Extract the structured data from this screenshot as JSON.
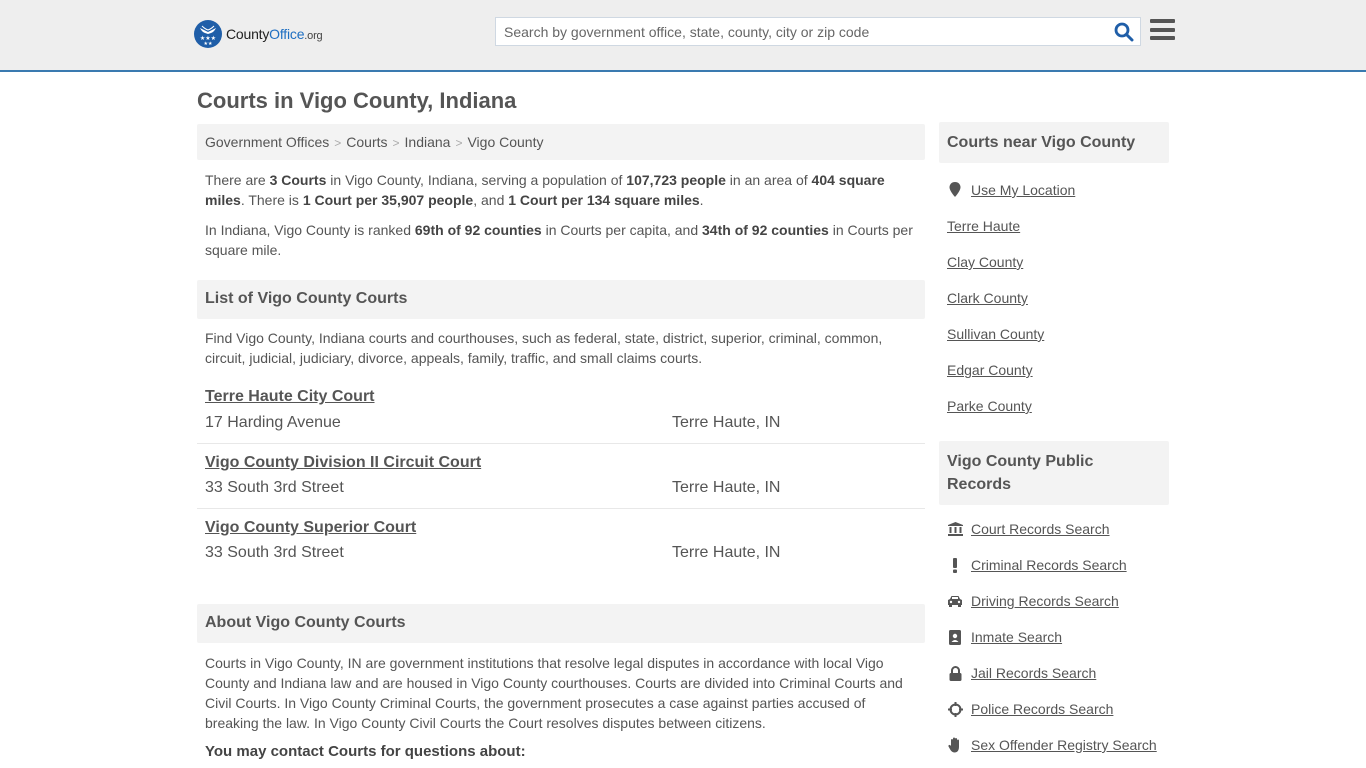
{
  "header": {
    "logo": {
      "county": "County",
      "office": "Office",
      "org": ".org"
    },
    "search_placeholder": "Search by government office, state, county, city or zip code",
    "colors": {
      "accent": "#3a7ab0",
      "brand": "#1f5ea8",
      "search_icon": "#1f5ea8"
    }
  },
  "page": {
    "title": "Courts in Vigo County, Indiana",
    "breadcrumb": [
      "Government Offices",
      "Courts",
      "Indiana",
      "Vigo County"
    ],
    "summary": {
      "t1": "There are ",
      "b1": "3 Courts",
      "t2": " in Vigo County, Indiana, serving a population of ",
      "b2": "107,723 people",
      "t3": " in an area of ",
      "b3": "404 square miles",
      "t4": ". There is ",
      "b4": "1 Court per 35,907 people",
      "t5": ", and ",
      "b5": "1 Court per 134 square miles",
      "t6": "."
    },
    "ranking": {
      "t1": "In Indiana, Vigo County is ranked ",
      "b1": "69th of 92 counties",
      "t2": " in Courts per capita, and ",
      "b2": "34th of 92 counties",
      "t3": " in Courts per square mile."
    },
    "list_heading": "List of Vigo County Courts",
    "list_intro": "Find Vigo County, Indiana courts and courthouses, such as federal, state, district, superior, criminal, common, circuit, judicial, judiciary, divorce, appeals, family, traffic, and small claims courts.",
    "courts": [
      {
        "name": "Terre Haute City Court",
        "address": "17 Harding Avenue",
        "city": "Terre Haute, IN"
      },
      {
        "name": "Vigo County Division II Circuit Court",
        "address": "33 South 3rd Street",
        "city": "Terre Haute, IN"
      },
      {
        "name": "Vigo County Superior Court",
        "address": "33 South 3rd Street",
        "city": "Terre Haute, IN"
      }
    ],
    "about_heading": "About Vigo County Courts",
    "about_text": "Courts in Vigo County, IN are government institutions that resolve legal disputes in accordance with local Vigo County and Indiana law and are housed in Vigo County courthouses. Courts are divided into Criminal Courts and Civil Courts. In Vigo County Criminal Courts, the government prosecutes a case against parties accused of breaking the law. In Vigo County Civil Courts the Court resolves disputes between citizens.",
    "contact_heading": "You may contact Courts for questions about:"
  },
  "sidebar": {
    "nearby": {
      "heading": "Courts near Vigo County",
      "use_location": {
        "label": "Use My Location",
        "icon": "map-marker-icon"
      },
      "items": [
        "Terre Haute",
        "Clay County",
        "Clark County",
        "Sullivan County",
        "Edgar County",
        "Parke County"
      ]
    },
    "records": {
      "heading": "Vigo County Public Records",
      "items": [
        {
          "label": "Court Records Search",
          "icon": "courthouse-icon"
        },
        {
          "label": "Criminal Records Search",
          "icon": "exclamation-icon"
        },
        {
          "label": "Driving Records Search",
          "icon": "car-icon"
        },
        {
          "label": "Inmate Search",
          "icon": "id-badge-icon"
        },
        {
          "label": "Jail Records Search",
          "icon": "lock-icon"
        },
        {
          "label": "Police Records Search",
          "icon": "crosshairs-icon"
        },
        {
          "label": "Sex Offender Registry Search",
          "icon": "hand-icon"
        }
      ]
    }
  }
}
